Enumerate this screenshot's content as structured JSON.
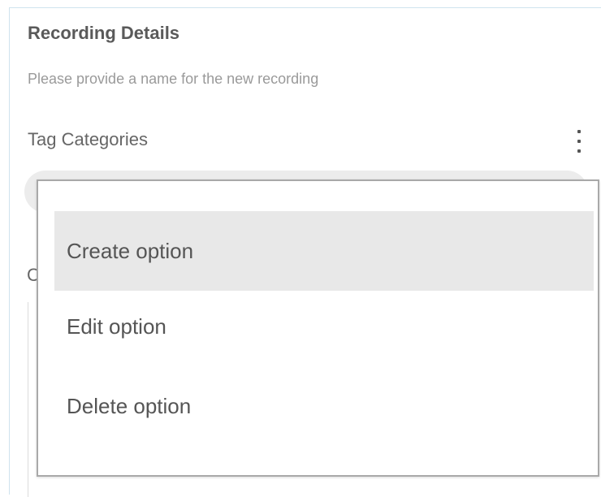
{
  "panel": {
    "title": "Recording Details",
    "subtitle": "Please provide a name for the new recording",
    "tag_categories_label": "Tag Categories",
    "more_icon": "more-vertical-icon",
    "obscured_label_letter": "C"
  },
  "menu": {
    "items": [
      {
        "label": "Create option",
        "highlighted": true
      },
      {
        "label": "Edit option",
        "highlighted": false
      },
      {
        "label": "Delete option",
        "highlighted": false
      }
    ]
  },
  "colors": {
    "panel_border": "#cfe3ee",
    "menu_border": "#a9a9a9",
    "highlight": "#e8e8e8",
    "pill": "#ececec"
  }
}
